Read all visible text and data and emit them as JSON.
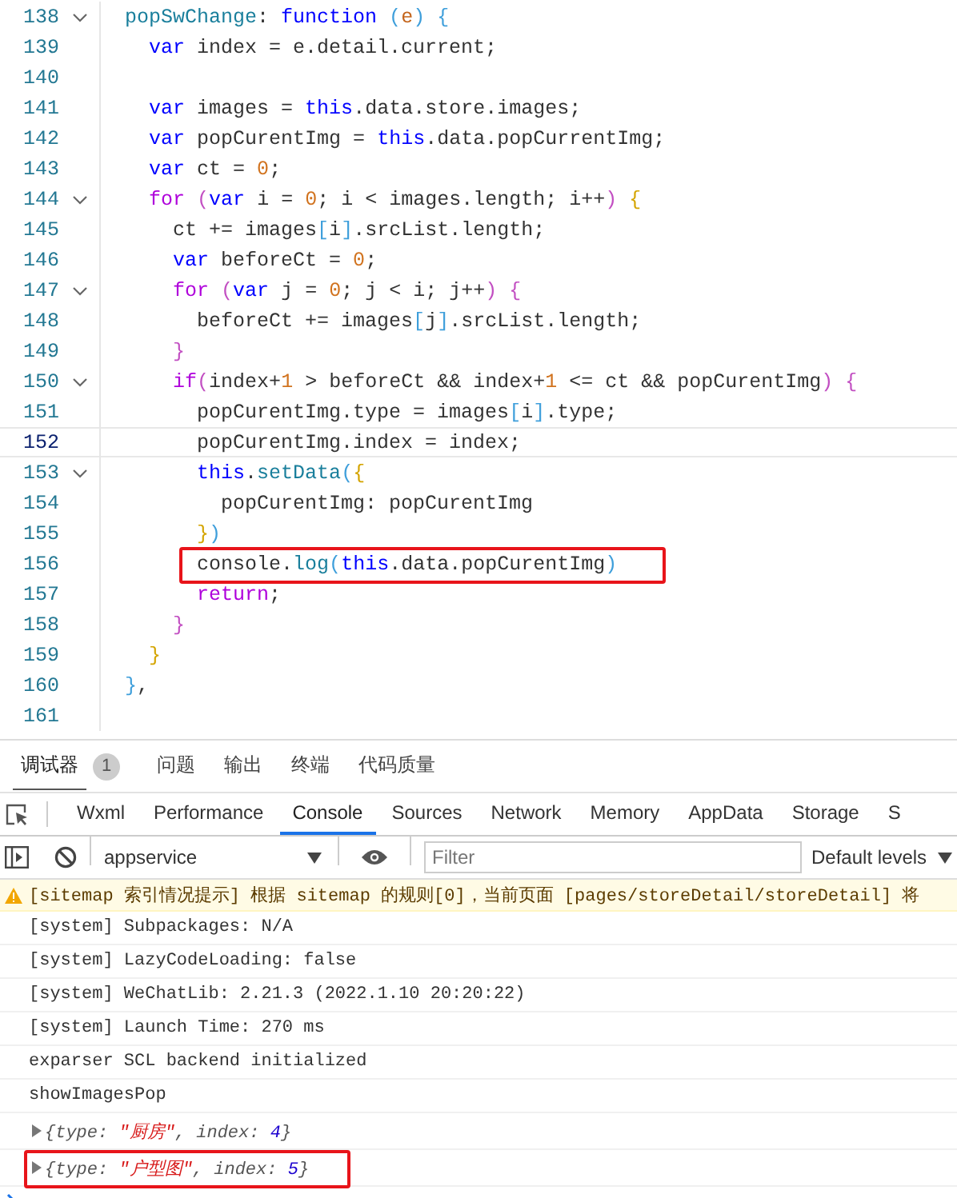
{
  "editor": {
    "lines": [
      {
        "number": "138",
        "foldable": true,
        "current": false,
        "highlighted": false,
        "tokens": [
          {
            "text": "popSwChange",
            "kind": "fn"
          },
          {
            "text": ": ",
            "kind": "plain"
          },
          {
            "text": "function ",
            "kind": "keyword"
          },
          {
            "text": "(",
            "kind": "bracket3"
          },
          {
            "text": "e",
            "kind": "param"
          },
          {
            "text": ") ",
            "kind": "bracket3"
          },
          {
            "text": "{",
            "kind": "bracket3"
          }
        ]
      },
      {
        "number": "139",
        "foldable": false,
        "current": false,
        "highlighted": false,
        "tokens": [
          {
            "text": "  var",
            "kind": "keyword"
          },
          {
            "text": " index = e.detail.current;",
            "kind": "plain"
          }
        ]
      },
      {
        "number": "140",
        "foldable": false,
        "current": false,
        "highlighted": false
      },
      {
        "number": "141",
        "foldable": false,
        "current": false,
        "highlighted": false,
        "tokens": [
          {
            "text": "  var",
            "kind": "keyword"
          },
          {
            "text": " images = ",
            "kind": "plain"
          },
          {
            "text": "this",
            "kind": "keyword"
          },
          {
            "text": ".data.store.images;",
            "kind": "plain"
          }
        ]
      },
      {
        "number": "142",
        "foldable": false,
        "current": false,
        "highlighted": false,
        "tokens": [
          {
            "text": "  var",
            "kind": "keyword"
          },
          {
            "text": " popCurentImg = ",
            "kind": "plain"
          },
          {
            "text": "this",
            "kind": "keyword"
          },
          {
            "text": ".data.popCurrentImg;",
            "kind": "plain"
          }
        ]
      },
      {
        "number": "143",
        "foldable": false,
        "current": false,
        "highlighted": false,
        "tokens": [
          {
            "text": "  var",
            "kind": "keyword"
          },
          {
            "text": " ct = ",
            "kind": "plain"
          },
          {
            "text": "0",
            "kind": "number"
          },
          {
            "text": ";",
            "kind": "plain"
          }
        ]
      },
      {
        "number": "144",
        "foldable": true,
        "current": false,
        "highlighted": false,
        "tokens": [
          {
            "text": "  for ",
            "kind": "control"
          },
          {
            "text": "(",
            "kind": "bracket2"
          },
          {
            "text": "var",
            "kind": "keyword"
          },
          {
            "text": " i = ",
            "kind": "plain"
          },
          {
            "text": "0",
            "kind": "number"
          },
          {
            "text": "; i < images.length; i++",
            "kind": "plain"
          },
          {
            "text": ") ",
            "kind": "bracket2"
          },
          {
            "text": "{",
            "kind": "bracket1"
          }
        ]
      },
      {
        "number": "145",
        "foldable": false,
        "current": false,
        "highlighted": false,
        "tokens": [
          {
            "text": "    ct += images",
            "kind": "plain"
          },
          {
            "text": "[",
            "kind": "bracket3"
          },
          {
            "text": "i",
            "kind": "plain"
          },
          {
            "text": "]",
            "kind": "bracket3"
          },
          {
            "text": ".srcList.length;",
            "kind": "plain"
          }
        ]
      },
      {
        "number": "146",
        "foldable": false,
        "current": false,
        "highlighted": false,
        "tokens": [
          {
            "text": "    var",
            "kind": "keyword"
          },
          {
            "text": " beforeCt = ",
            "kind": "plain"
          },
          {
            "text": "0",
            "kind": "number"
          },
          {
            "text": ";",
            "kind": "plain"
          }
        ]
      },
      {
        "number": "147",
        "foldable": true,
        "current": false,
        "highlighted": false,
        "tokens": [
          {
            "text": "    for ",
            "kind": "control"
          },
          {
            "text": "(",
            "kind": "bracket2"
          },
          {
            "text": "var",
            "kind": "keyword"
          },
          {
            "text": " j = ",
            "kind": "plain"
          },
          {
            "text": "0",
            "kind": "number"
          },
          {
            "text": "; j < i; j++",
            "kind": "plain"
          },
          {
            "text": ") ",
            "kind": "bracket2"
          },
          {
            "text": "{",
            "kind": "bracket2"
          }
        ]
      },
      {
        "number": "148",
        "foldable": false,
        "current": false,
        "highlighted": false,
        "tokens": [
          {
            "text": "      beforeCt += images",
            "kind": "plain"
          },
          {
            "text": "[",
            "kind": "bracket3"
          },
          {
            "text": "j",
            "kind": "plain"
          },
          {
            "text": "]",
            "kind": "bracket3"
          },
          {
            "text": ".srcList.length;",
            "kind": "plain"
          }
        ]
      },
      {
        "number": "149",
        "foldable": false,
        "current": false,
        "highlighted": false,
        "tokens": [
          {
            "text": "    }",
            "kind": "bracket2"
          }
        ]
      },
      {
        "number": "150",
        "foldable": true,
        "current": false,
        "highlighted": false,
        "tokens": [
          {
            "text": "    if",
            "kind": "control"
          },
          {
            "text": "(",
            "kind": "bracket2"
          },
          {
            "text": "index+",
            "kind": "plain"
          },
          {
            "text": "1",
            "kind": "number"
          },
          {
            "text": " > beforeCt && index+",
            "kind": "plain"
          },
          {
            "text": "1",
            "kind": "number"
          },
          {
            "text": " <= ct && popCurentImg",
            "kind": "plain"
          },
          {
            "text": ") ",
            "kind": "bracket2"
          },
          {
            "text": "{",
            "kind": "bracket2"
          }
        ]
      },
      {
        "number": "151",
        "foldable": false,
        "current": false,
        "highlighted": false,
        "tokens": [
          {
            "text": "      popCurentImg.type = images",
            "kind": "plain"
          },
          {
            "text": "[",
            "kind": "bracket3"
          },
          {
            "text": "i",
            "kind": "plain"
          },
          {
            "text": "]",
            "kind": "bracket3"
          },
          {
            "text": ".type;",
            "kind": "plain"
          }
        ]
      },
      {
        "number": "152",
        "foldable": false,
        "current": true,
        "highlighted": false,
        "tokens": [
          {
            "text": "      popCurentImg.index = index;",
            "kind": "plain"
          }
        ]
      },
      {
        "number": "153",
        "foldable": true,
        "current": false,
        "highlighted": false,
        "tokens": [
          {
            "text": "      this",
            "kind": "keyword"
          },
          {
            "text": ".",
            "kind": "plain"
          },
          {
            "text": "setData",
            "kind": "fn"
          },
          {
            "text": "(",
            "kind": "bracket3"
          },
          {
            "text": "{",
            "kind": "bracket1"
          }
        ]
      },
      {
        "number": "154",
        "foldable": false,
        "current": false,
        "highlighted": false,
        "tokens": [
          {
            "text": "        popCurentImg: popCurentImg",
            "kind": "plain"
          }
        ]
      },
      {
        "number": "155",
        "foldable": false,
        "current": false,
        "highlighted": false,
        "tokens": [
          {
            "text": "      }",
            "kind": "bracket1"
          },
          {
            "text": ")",
            "kind": "bracket3"
          }
        ]
      },
      {
        "number": "156",
        "foldable": false,
        "current": false,
        "highlighted": true,
        "tokens": [
          {
            "text": "      console.",
            "kind": "plain"
          },
          {
            "text": "log",
            "kind": "fn"
          },
          {
            "text": "(",
            "kind": "bracket3"
          },
          {
            "text": "this",
            "kind": "keyword"
          },
          {
            "text": ".data.popCurentImg",
            "kind": "plain"
          },
          {
            "text": ")",
            "kind": "bracket3"
          }
        ]
      },
      {
        "number": "157",
        "foldable": false,
        "current": false,
        "highlighted": false,
        "tokens": [
          {
            "text": "      return",
            "kind": "control"
          },
          {
            "text": ";",
            "kind": "plain"
          }
        ]
      },
      {
        "number": "158",
        "foldable": false,
        "current": false,
        "highlighted": false,
        "tokens": [
          {
            "text": "    }",
            "kind": "bracket2"
          }
        ]
      },
      {
        "number": "159",
        "foldable": false,
        "current": false,
        "highlighted": false,
        "tokens": [
          {
            "text": "  }",
            "kind": "bracket1"
          }
        ]
      },
      {
        "number": "160",
        "foldable": false,
        "current": false,
        "highlighted": false,
        "tokens": [
          {
            "text": "}",
            "kind": "bracket3"
          },
          {
            "text": ",",
            "kind": "plain"
          }
        ]
      },
      {
        "number": "161",
        "foldable": false,
        "current": false,
        "highlighted": false
      }
    ]
  },
  "panel_tabs": [
    {
      "label": "调试器",
      "selected": true,
      "badge": "1"
    },
    {
      "label": "问题",
      "selected": false
    },
    {
      "label": "输出",
      "selected": false
    },
    {
      "label": "终端",
      "selected": false
    },
    {
      "label": "代码质量",
      "selected": false
    }
  ],
  "devtools_tabs": [
    {
      "label": "Wxml",
      "selected": false
    },
    {
      "label": "Performance",
      "selected": false
    },
    {
      "label": "Console",
      "selected": true
    },
    {
      "label": "Sources",
      "selected": false
    },
    {
      "label": "Network",
      "selected": false
    },
    {
      "label": "Memory",
      "selected": false
    },
    {
      "label": "AppData",
      "selected": false
    },
    {
      "label": "Storage",
      "selected": false
    },
    {
      "label": "S",
      "selected": false
    }
  ],
  "toolbar": {
    "context": "appservice",
    "filter_placeholder": "Filter",
    "levels": "Default levels"
  },
  "console": [
    {
      "kind": "warning",
      "text": "[sitemap 索引情况提示] 根据 sitemap 的规则[0]，当前页面 [pages/storeDetail/storeDetail] 将"
    },
    {
      "kind": "log",
      "text": "[system] Subpackages: N/A"
    },
    {
      "kind": "log",
      "text": "[system] LazyCodeLoading: false"
    },
    {
      "kind": "log",
      "text": "[system] WeChatLib: 2.21.3 (2022.1.10 20:20:22)"
    },
    {
      "kind": "log",
      "text": "[system] Launch Time: 270 ms"
    },
    {
      "kind": "log",
      "text": "exparser SCL backend initialized"
    },
    {
      "kind": "log",
      "text": "showImagesPop"
    },
    {
      "kind": "object",
      "highlighted": false,
      "tokens": [
        {
          "text": "{type: ",
          "kind": "key"
        },
        {
          "text": "\"厨房\"",
          "kind": "string"
        },
        {
          "text": ", index: ",
          "kind": "key"
        },
        {
          "text": "4",
          "kind": "number"
        },
        {
          "text": "}",
          "kind": "key"
        }
      ]
    },
    {
      "kind": "object",
      "highlighted": true,
      "tokens": [
        {
          "text": "{type: ",
          "kind": "key"
        },
        {
          "text": "\"户型图\"",
          "kind": "string"
        },
        {
          "text": ", index: ",
          "kind": "key"
        },
        {
          "text": "5",
          "kind": "number"
        },
        {
          "text": "}",
          "kind": "key"
        }
      ]
    }
  ]
}
